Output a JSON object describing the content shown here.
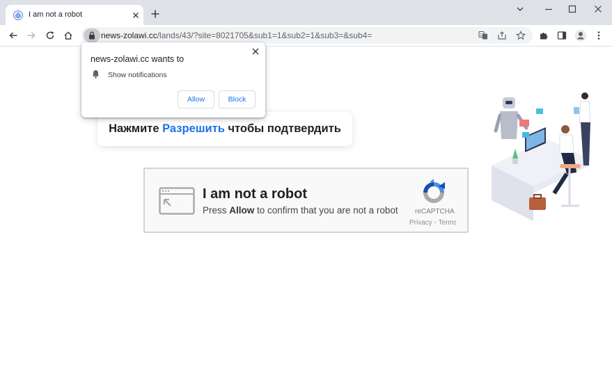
{
  "browser": {
    "tab_title": "I am not a robot",
    "url_host": "news-zolawi.cc",
    "url_path": "/lands/43/?site=8021705&sub1=1&sub2=1&sub3=&sub4="
  },
  "permission_prompt": {
    "title": "news-zolawi.cc wants to",
    "item": "Show notifications",
    "allow_label": "Allow",
    "block_label": "Block"
  },
  "banner": {
    "prefix": "Нажмите ",
    "accent": "Разрешить",
    "suffix": " чтобы подтвердить"
  },
  "captcha": {
    "title": "I am not a robot",
    "sub_prefix": "Press ",
    "sub_bold": "Allow",
    "sub_suffix": " to confirm that you are not a robot",
    "brand": "reCAPTCHA",
    "links": "Privacy - Terms"
  },
  "colors": {
    "accent": "#1a73e8",
    "tabbar": "#dee1e6",
    "omnibox": "#f1f3f4"
  }
}
